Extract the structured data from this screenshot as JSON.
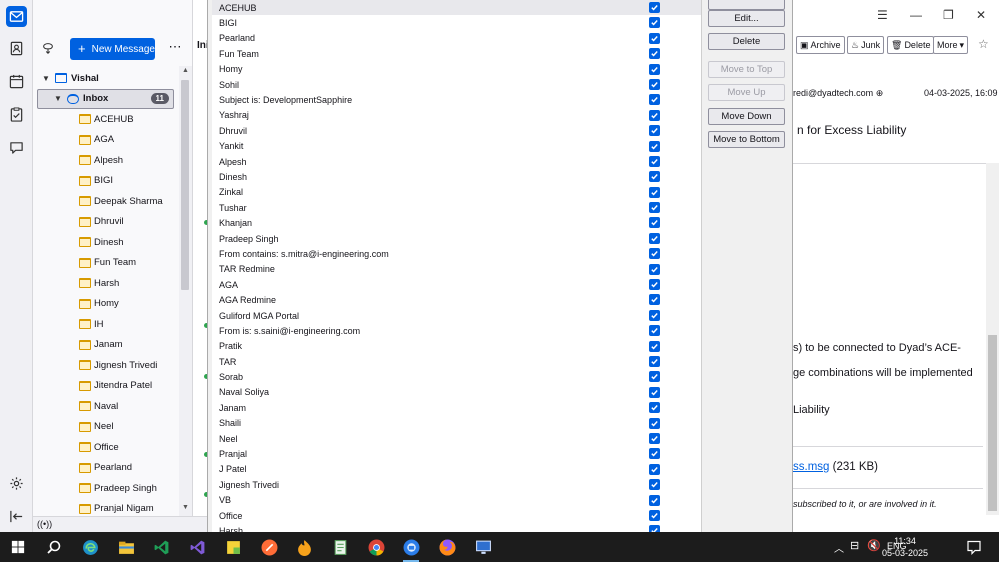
{
  "folder_pane": {
    "new_message_label": "New Message",
    "account": "Vishal",
    "inbox": {
      "label": "Inbox",
      "count": "11"
    },
    "folders": [
      "ACEHUB",
      "AGA",
      "Alpesh",
      "BIGI",
      "Deepak Sharma",
      "Dhruvil",
      "Dinesh",
      "Fun Team",
      "Harsh",
      "Homy",
      "IH",
      "Janam",
      "Jignesh Trivedi",
      "Jitendra Patel",
      "Naval",
      "Neel",
      "Office",
      "Pearland",
      "Pradeep Singh",
      "Pranjal Nigam"
    ]
  },
  "thread_pane": {
    "tab_label": "Ini"
  },
  "filter_dialog": {
    "filters": [
      {
        "name": "ACEHUB",
        "enabled": true,
        "selected": true
      },
      {
        "name": "BIGI",
        "enabled": true
      },
      {
        "name": "Pearland",
        "enabled": true
      },
      {
        "name": "Fun Team",
        "enabled": true
      },
      {
        "name": "Homy",
        "enabled": true
      },
      {
        "name": "Sohil",
        "enabled": true
      },
      {
        "name": "Subject is: DevelopmentSapphire",
        "enabled": true
      },
      {
        "name": "Yashraj",
        "enabled": true
      },
      {
        "name": "Dhruvil",
        "enabled": true
      },
      {
        "name": "Yankit",
        "enabled": true
      },
      {
        "name": "Alpesh",
        "enabled": true
      },
      {
        "name": "Dinesh",
        "enabled": true
      },
      {
        "name": "Zinkal",
        "enabled": true
      },
      {
        "name": "Tushar",
        "enabled": true
      },
      {
        "name": "Khanjan",
        "enabled": true
      },
      {
        "name": "Pradeep Singh",
        "enabled": true
      },
      {
        "name": "From contains: s.mitra@i-engineering.com",
        "enabled": true
      },
      {
        "name": "TAR Redmine",
        "enabled": true
      },
      {
        "name": "AGA",
        "enabled": true
      },
      {
        "name": "AGA Redmine",
        "enabled": true
      },
      {
        "name": "Guliford MGA Portal",
        "enabled": true
      },
      {
        "name": "From is: s.saini@i-engineering.com",
        "enabled": true
      },
      {
        "name": "Pratik",
        "enabled": true
      },
      {
        "name": "TAR",
        "enabled": true
      },
      {
        "name": "Sorab",
        "enabled": true
      },
      {
        "name": "Naval Soliya",
        "enabled": true
      },
      {
        "name": "Janam",
        "enabled": true
      },
      {
        "name": "Shaili",
        "enabled": true
      },
      {
        "name": "Neel",
        "enabled": true
      },
      {
        "name": "Pranjal",
        "enabled": true
      },
      {
        "name": "J Patel",
        "enabled": true
      },
      {
        "name": "Jignesh Trivedi",
        "enabled": true
      },
      {
        "name": "VB",
        "enabled": true
      },
      {
        "name": "Office",
        "enabled": true
      },
      {
        "name": "Harsh",
        "enabled": true
      }
    ],
    "buttons": {
      "edit": "Edit...",
      "delete": "Delete",
      "move_to_top": "Move to Top",
      "move_up": "Move Up",
      "move_down": "Move Down",
      "move_to_bottom": "Move to Bottom"
    }
  },
  "message_pane": {
    "toolbar": {
      "archive": "Archive",
      "junk": "Junk",
      "delete": "Delete",
      "more": "More"
    },
    "from": "redi@dyadtech.com",
    "date": "04-03-2025, 16:09",
    "subject": "n for Excess Liability",
    "body_lines": [
      "s) to be connected to Dyad’s ACE-",
      "ge combinations will be implemented",
      "Liability"
    ],
    "attachment_name": "ss.msg",
    "attachment_size": "(231 KB)",
    "footer_note": "subscribed to it, or are involved in it."
  },
  "taskbar": {
    "language": "ENG",
    "time": "11:34",
    "date": "05-03-2025"
  },
  "colors": {
    "accent": "#0061e0",
    "taskbar": "#1c1c1c",
    "folder": "#d79a00"
  }
}
